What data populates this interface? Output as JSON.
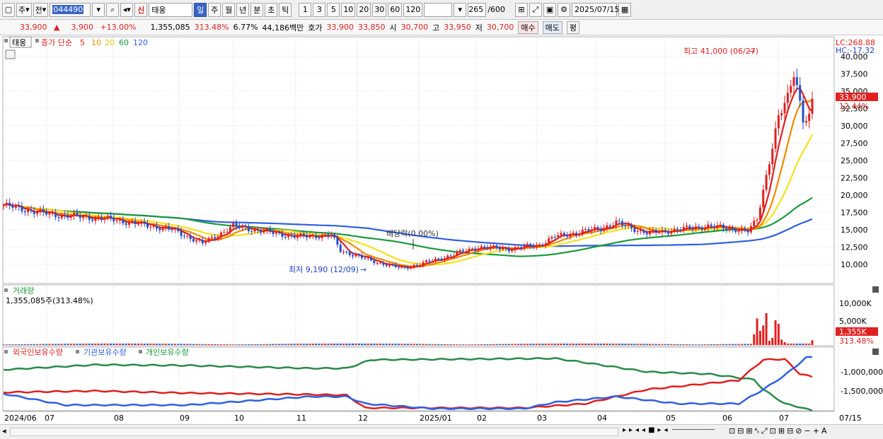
{
  "toolbar": {
    "mode1": "주",
    "mode2": "전",
    "code": "044490",
    "market_badge": "신",
    "name": "태웅",
    "periods": [
      "일",
      "주",
      "월",
      "년",
      "분",
      "초",
      "틱"
    ],
    "intervals": [
      "1",
      "3",
      "5",
      "10",
      "20",
      "30",
      "60",
      "120"
    ],
    "count": "265",
    "count_total": "/600",
    "date": "2025/07/15"
  },
  "quote": {
    "price": "33,900",
    "change": "3,900",
    "change_pct": "+13.00%",
    "volume": "1,355,085",
    "vol_ratio": "313.48%",
    "turnover": "6.77%",
    "amount": "44,186백만",
    "hoga_label": "호가",
    "ask": "33,900",
    "bid": "33,850",
    "open_label": "시",
    "open": "30,700",
    "high_label": "고",
    "high": "33,950",
    "low_label": "저",
    "low": "30,700",
    "buy_label": "매수",
    "sell_label": "매도",
    "eval_label": "평"
  },
  "price_panel": {
    "name": "태웅",
    "legend_title": "종가 단순",
    "ma": [
      {
        "label": "5",
        "color": "#e02020"
      },
      {
        "label": "10",
        "color": "#f08a00"
      },
      {
        "label": "20",
        "color": "#f5e11a"
      },
      {
        "label": "60",
        "color": "#1a9a3a"
      },
      {
        "label": "120",
        "color": "#3060e0"
      }
    ],
    "lc": "LC:268.88",
    "hc": "HC:-17.32",
    "y_ticks": [
      "40,000",
      "37,500",
      "35,000",
      "32,500",
      "30,000",
      "27,500",
      "25,000",
      "22,500",
      "20,000",
      "17,500",
      "15,000",
      "12,500",
      "10,000"
    ],
    "current_price_label": "33,900",
    "current_pct_label": "12.44%",
    "annot_high": "최고 41,000 (06/27)",
    "annot_low": "최저 9,190 (12/09)",
    "annot_div": "배당락(0.00%)"
  },
  "volume_panel": {
    "title": "거래량",
    "value": "1,355,085주(313.48%)",
    "y_ticks": [
      "10,000K",
      "5,000K"
    ],
    "current_label": "1,355K",
    "current_pct": "313.48%"
  },
  "holdings_panel": {
    "legend": [
      {
        "label": "외국인보유수량",
        "color": "#e02020"
      },
      {
        "label": "기관보유수량",
        "color": "#3060e0"
      },
      {
        "label": "개인보유수량",
        "color": "#1a9a3a"
      }
    ],
    "y_ticks": [
      "-1,000,000",
      "-1,500,000"
    ]
  },
  "x_axis": [
    "2024/06",
    "07",
    "08",
    "09",
    "10",
    "11",
    "12",
    "2025/01",
    "02",
    "03",
    "04",
    "05",
    "06",
    "07",
    "07/15"
  ]
}
